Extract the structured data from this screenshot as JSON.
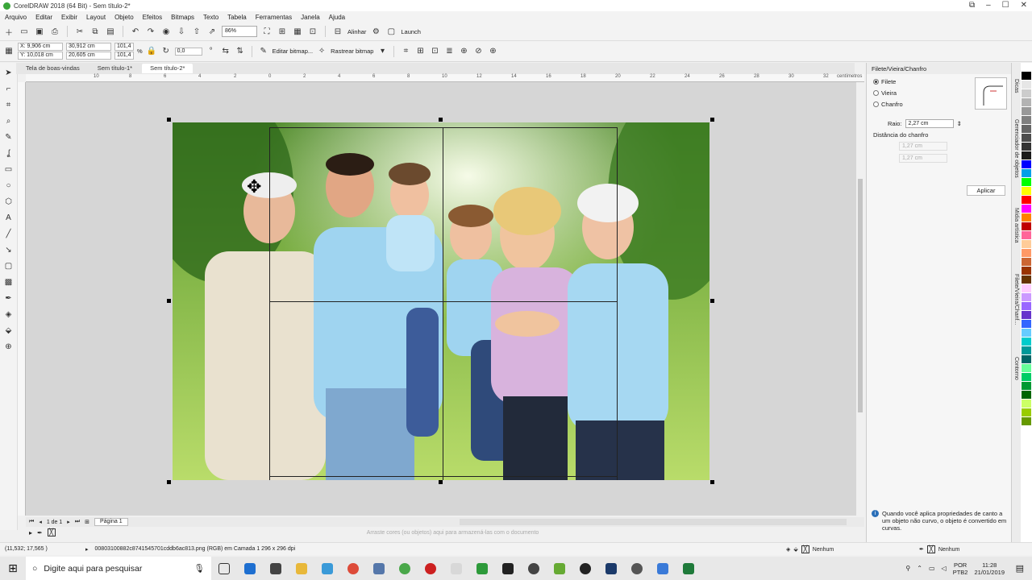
{
  "window": {
    "title": "CorelDRAW 2018 (64 Bit) - Sem título-2*"
  },
  "menu": [
    "Arquivo",
    "Editar",
    "Exibir",
    "Layout",
    "Objeto",
    "Efeitos",
    "Bitmaps",
    "Texto",
    "Tabela",
    "Ferramentas",
    "Janela",
    "Ajuda"
  ],
  "toolbar": {
    "zoom": "86%",
    "align_label": "Alinhar",
    "launch_label": "Launch"
  },
  "property_bar": {
    "x": "X: 9,906 cm",
    "y": "Y: 10,018 cm",
    "w": "30,912 cm",
    "h": "20,605 cm",
    "scale_w": "101,4",
    "scale_h": "101,4",
    "pct": "%",
    "angle": "0,0",
    "edit_bitmap": "Editar bitmap...",
    "trace_bitmap": "Rastrear bitmap"
  },
  "doc_tabs": [
    "Tela de boas-vindas",
    "Sem título-1*",
    "Sem título-2*"
  ],
  "ruler": {
    "ticks": [
      "10",
      "8",
      "6",
      "4",
      "2",
      "0",
      "2",
      "4",
      "6",
      "8",
      "10",
      "12",
      "14",
      "16",
      "18",
      "20",
      "22",
      "24",
      "26",
      "28",
      "30",
      "32"
    ],
    "unit": "centímetros"
  },
  "page_nav": {
    "counter": "1 de 1",
    "page_tab": "Página 1"
  },
  "color_hint": "Arraste cores (ou objetos) aqui para armazená-las com o documento",
  "status": {
    "coords": "(11,532; 17,565 )",
    "file": "00803100882c8741545701cddb6ac813.png (RGB) em Camada 1 296 x 296 dpi",
    "fill": "Nenhum",
    "outline": "Nenhum"
  },
  "docker": {
    "title": "Filete/Vieira/Chanfro",
    "options": [
      "Filete",
      "Vieira",
      "Chanfro"
    ],
    "selected": 0,
    "radius_label": "Raio:",
    "radius_value": "2,27 cm",
    "chamfer_label": "Distância do chanfro",
    "chamfer_a": "1,27 cm",
    "chamfer_b": "1,27 cm",
    "apply": "Aplicar",
    "info": "Quando você aplica propriedades de canto a um objeto não curvo, o objeto é convertido em curvas."
  },
  "side_tabs": [
    "Dicas",
    "Gerenciador de objetos",
    "Mídia artística",
    "Filete/Vieira/Chanf...",
    "Contorno"
  ],
  "palette": [
    "#ffffff",
    "#000000",
    "#e6e6e6",
    "#cccccc",
    "#b3b3b3",
    "#999999",
    "#808080",
    "#666666",
    "#4d4d4d",
    "#333333",
    "#1a1a1a",
    "#0000ff",
    "#00a0e8",
    "#00ff00",
    "#ffff00",
    "#ff0000",
    "#ff00ff",
    "#ff8000",
    "#c00000",
    "#ff6699",
    "#ffcc99",
    "#ff9966",
    "#cc6633",
    "#993300",
    "#663300",
    "#ffccff",
    "#cc99ff",
    "#9966ff",
    "#6633cc",
    "#3366ff",
    "#66ccff",
    "#00cccc",
    "#009999",
    "#006666",
    "#66ff99",
    "#00cc66",
    "#009933",
    "#006600",
    "#ccff66",
    "#99cc00",
    "#669900"
  ],
  "taskbar": {
    "search_placeholder": "Digite aqui para pesquisar",
    "lang": "POR",
    "layout": "PTB2",
    "time": "11:28",
    "date": "21/01/2019"
  }
}
